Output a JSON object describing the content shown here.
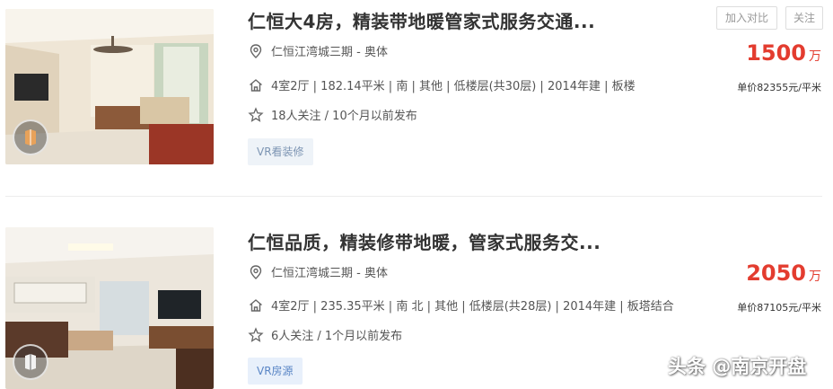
{
  "listings": [
    {
      "title": "仁恒大4房，精装带地暖管家式服务交通...",
      "location": "仁恒江湾城三期 - 奥体",
      "spec": "4室2厅 | 182.14平米 | 南 | 其他 | 低楼层(共30层) | 2014年建 | 板楼",
      "follow": "18人关注 / 10个月以前发布",
      "tag": "VR看装修",
      "price": "1500",
      "price_unit": "万",
      "unit_price": "单价82355元/平米",
      "compare_label": "加入对比",
      "follow_label": "关注"
    },
    {
      "title": "仁恒品质，精装修带地暖，管家式服务交...",
      "location": "仁恒江湾城三期 - 奥体",
      "spec": "4室2厅 | 235.35平米 | 南 北 | 其他 | 低楼层(共28层) | 2014年建 | 板塔结合",
      "follow": "6人关注 / 1个月以前发布",
      "tag": "VR房源",
      "price": "2050",
      "price_unit": "万",
      "unit_price": "单价87105元/平米"
    }
  ],
  "watermark": "头条 @南京开盘",
  "colors": {
    "price": "#e33c2f",
    "tag_text": "#7d95b3",
    "tag_bg": "#eef3f8",
    "tag2_text": "#5a86c6",
    "text": "#333333"
  },
  "icons": {
    "location": "location-pin-icon",
    "spec": "house-icon",
    "follow": "star-icon",
    "vr": "vr-badge-icon"
  }
}
